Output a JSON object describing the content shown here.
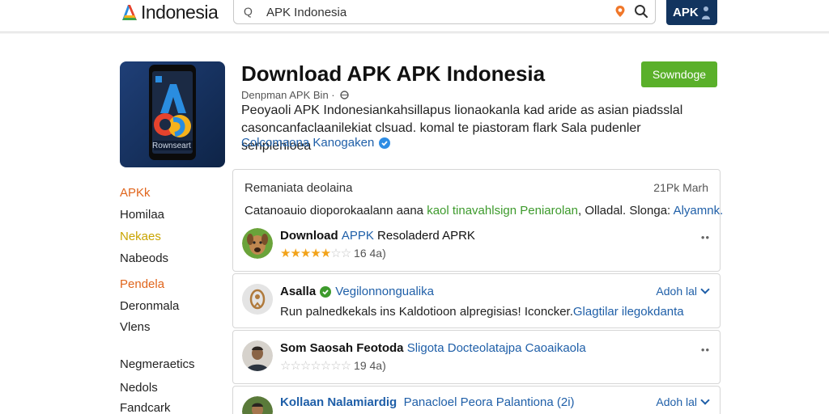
{
  "header": {
    "logo_text": "Indonesia",
    "search_lead": "Q",
    "search_value": "APK Indonesia",
    "apk_button": "APK"
  },
  "app": {
    "title": "Download APK APK Indonesia",
    "meta": "Denpman APK Bin ·",
    "description_line1": "Peoyaoli APK Indonesiankahsillapus lionaokanla kad aride as asian piadsslal",
    "description_line2": "casoncanfaclaanilekiat clsuad. komal te piastoram flark Sala pudenler senplehloea",
    "link_text": "Colcomaona Kanogaken",
    "download_label": "Sowndoge",
    "icon_caption": "Rownseart"
  },
  "sidebar": {
    "items": [
      {
        "label": "APKk",
        "color": "#e0651c"
      },
      {
        "label": "Homilaa",
        "color": "#222222"
      },
      {
        "label": "Nekaes",
        "color": "#c9a400"
      },
      {
        "label": "Nabeods",
        "color": "#222222"
      },
      {
        "label": "Pendela",
        "color": "#e0651c"
      },
      {
        "label": "Deronmala",
        "color": "#222222"
      },
      {
        "label": "Vlens",
        "color": "#222222"
      },
      {
        "label": "Negmeraetics",
        "color": "#222222"
      },
      {
        "label": "Nedols",
        "color": "#222222"
      },
      {
        "label": "Fandcark",
        "color": "#222222"
      }
    ]
  },
  "summary_card": {
    "heading": "Remaniata deolaina",
    "date": "21Pk Marh",
    "line_a": "Catanoauio dioporokaalann aana ",
    "line_b": "kaol ",
    "line_c": "tinavahlsign Peniarolan",
    "line_d": ", Olladal. Slonga: ",
    "line_e": "Alyamnk."
  },
  "reviews": [
    {
      "title": "Download ",
      "title_blue": "APPK",
      "title_rest": " Resoladerd APRK",
      "stars_full": "★★★★★",
      "stars_empty": "☆☆",
      "count": "16 4a)"
    },
    {
      "title": "Asalla",
      "title_blue": "Vegilonnongualika",
      "action": "Adoh lal",
      "text": "Run palnedkekals ins Kaldotioon alpregisias! Iconcker. ",
      "text_blue": "Glagtilar ilegokdanta"
    },
    {
      "title": "Som Saosah Feotoda",
      "title_blue": "Sligota Docteolatajpa Caoaikaola",
      "stars_full": "",
      "stars_empty": "☆☆☆☆☆☆☆",
      "count": "19 4a)"
    },
    {
      "title": "Kollaan Nalamiardig",
      "title_blue": "Panacloel Peora Palantiona (2i)",
      "action": "Adoh lal"
    }
  ],
  "colors": {
    "brand_navy": "#12345f",
    "download_green": "#5ab02a",
    "link_blue": "#1f5fa8",
    "star_orange": "#f2a31a"
  },
  "icons": [
    "search-icon",
    "map-pin-icon",
    "verified-badge-icon",
    "more-icon",
    "chevron-down-icon",
    "shield-icon"
  ]
}
